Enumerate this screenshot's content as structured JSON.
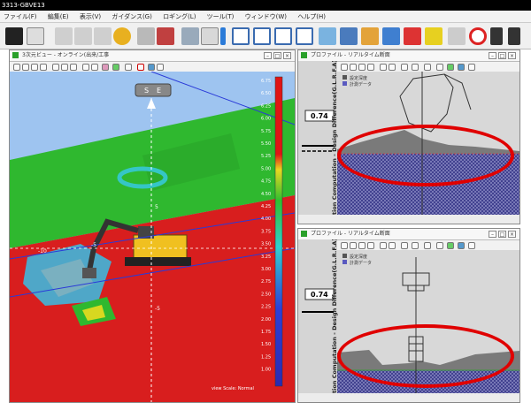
{
  "window": {
    "title": "3313-GBVE13"
  },
  "menu": [
    "ファイル(F)",
    "編集(E)",
    "表示(V)",
    "ガイダンス(G)",
    "ロギング(L)",
    "ツール(T)",
    "ウィンドウ(W)",
    "ヘルプ(H)"
  ],
  "view3d": {
    "title": "3次元ビュー - オンライン(出来/工事",
    "north_letters": [
      "S",
      "E"
    ],
    "grid_labels": [
      "-10",
      "-5",
      "5",
      "-5"
    ],
    "scale_values": [
      "6.75",
      "6.50",
      "6.25",
      "6.00",
      "5.75",
      "5.50",
      "5.25",
      "5.00",
      "4.75",
      "4.50",
      "4.25",
      "4.00",
      "3.75",
      "3.50",
      "3.25",
      "3.00",
      "2.75",
      "2.50",
      "2.25",
      "2.00",
      "1.75",
      "1.50",
      "1.25",
      "1.00"
    ],
    "watermark": "view Scale: Normal"
  },
  "profile_top": {
    "title": "プロファイル - リアルタイム断面",
    "value": "0.74",
    "vertical_label": "tion Computation - Design Difference(G.L.R.F.A)",
    "legend": [
      "設定深度",
      "計測データ"
    ]
  },
  "profile_bottom": {
    "title": "プロファイル - リアルタイム断面",
    "value": "0.74",
    "vertical_label": "tion Computation - Design Difference(G.L.R.F.A)",
    "legend": [
      "設定深度",
      "計測データ"
    ]
  },
  "colors": {
    "highlight": "#e00000",
    "surface_green": "#2fb82f",
    "surface_red": "#d81e1e",
    "hatch_blue": "#4a4a9a"
  }
}
